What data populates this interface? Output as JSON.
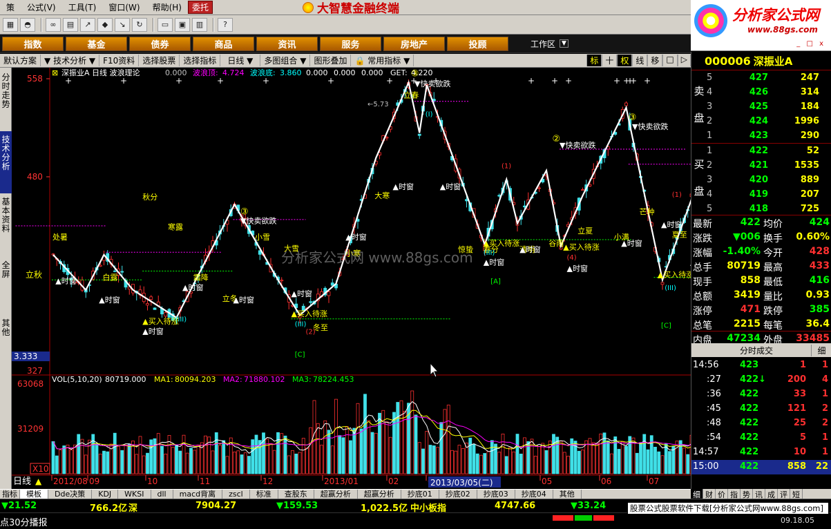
{
  "menubar": {
    "items": [
      "策",
      "公式",
      "工具",
      "窗口",
      "帮助"
    ],
    "shortcuts": [
      "",
      "(V)",
      "(T)",
      "(W)",
      "(H)"
    ],
    "trade_label": "委托",
    "app_title": "大智慧金融终端"
  },
  "toolbar": {
    "icons": [
      "tile-icon",
      "hat-icon",
      "binoculars-icon",
      "grid-icon",
      "buy-arrow-icon",
      "diamond-icon",
      "sell-arrow-icon",
      "refresh-icon",
      "notes-icon",
      "window-icon",
      "books-icon",
      "help-icon"
    ]
  },
  "brand": {
    "name": "分析家公式网",
    "url": "www.88gs.com",
    "window_controls": "_ □ x"
  },
  "navbar": {
    "items": [
      "指数",
      "基金",
      "债券",
      "商品",
      "资讯",
      "服务",
      "房地产",
      "投顾"
    ],
    "workspace_label": "工作区"
  },
  "tabstrip": {
    "items": [
      "默认方案",
      "技术分析",
      "F10资料",
      "选择股票",
      "选择指标",
      "日线",
      "多图组合",
      "图形叠加",
      "常用指标"
    ],
    "right_items": [
      "标",
      "十",
      "权",
      "线",
      "移",
      "□",
      "▷"
    ]
  },
  "lefttabs": {
    "items": [
      "分时走势",
      "技术分析",
      "基本资料",
      "全屏",
      "其他"
    ]
  },
  "chart_data": {
    "type": "candlestick",
    "title": "深振业A 日线 波浪理论",
    "header_values": {
      "wave_top_label": "波浪顶:",
      "wave_top": "4.724",
      "wave_bottom_label": "波浪底:",
      "wave_bottom": "3.860",
      "v3": "0.000",
      "v4": "0.000",
      "v5": "0.000",
      "get_label": "GET:",
      "get": "4.220",
      "zero": "0.000"
    },
    "y_ticks": [
      "558",
      "480",
      "327"
    ],
    "y_ticks_secondary": [
      "立秋"
    ],
    "cursor_value": "3.333",
    "x_ticks": [
      "2012/08",
      "09",
      "10",
      "11",
      "12",
      "2013/01",
      "02",
      "03",
      "05",
      "06",
      "07"
    ],
    "cursor_date": "2013/03/05(二)",
    "period_label": "日线",
    "scale_label": "X10",
    "watermark": "分析家公式网  www.88gs.com",
    "solar_terms": [
      {
        "label": "处暑",
        "x": 0.2,
        "y": 430
      },
      {
        "label": "白露",
        "x": 14,
        "y": 398
      },
      {
        "label": "秋分",
        "x": 25,
        "y": 462
      },
      {
        "label": "寒露",
        "x": 32,
        "y": 438
      },
      {
        "label": "霜降",
        "x": 39,
        "y": 398
      },
      {
        "label": "立冬",
        "x": 47,
        "y": 381
      },
      {
        "label": "小雪",
        "x": 56,
        "y": 430
      },
      {
        "label": "大雪",
        "x": 64,
        "y": 421
      },
      {
        "label": "冬至",
        "x": 72,
        "y": 358
      },
      {
        "label": "小寒",
        "x": 81,
        "y": 417
      },
      {
        "label": "大寒",
        "x": 89,
        "y": 463
      },
      {
        "label": "立春",
        "x": 97,
        "y": 543
      },
      {
        "label": "惊蛰",
        "x": 112,
        "y": 420
      },
      {
        "label": "春分",
        "x": 119,
        "y": 420
      },
      {
        "label": "清明",
        "x": 129,
        "y": 420
      },
      {
        "label": "谷雨",
        "x": 137,
        "y": 425
      },
      {
        "label": "立夏",
        "x": 145,
        "y": 435
      },
      {
        "label": "小满",
        "x": 155,
        "y": 430
      },
      {
        "label": "芒种",
        "x": 162,
        "y": 450
      },
      {
        "label": "夏至",
        "x": 171,
        "y": 432
      },
      {
        "label": "小暑",
        "x": 178,
        "y": 395
      }
    ],
    "signals": [
      {
        "text": "时窗",
        "x": 1,
        "y": 395
      },
      {
        "text": "时窗",
        "x": 13,
        "y": 380
      },
      {
        "text": "时窗",
        "x": 25,
        "y": 355
      },
      {
        "text": "时窗",
        "x": 36,
        "y": 390
      },
      {
        "text": "时窗",
        "x": 50,
        "y": 380
      },
      {
        "text": "时窗",
        "x": 66,
        "y": 385
      },
      {
        "text": "时窗",
        "x": 81,
        "y": 430
      },
      {
        "text": "时窗",
        "x": 94,
        "y": 470
      },
      {
        "text": "时窗",
        "x": 107,
        "y": 470
      },
      {
        "text": "时窗",
        "x": 119,
        "y": 410
      },
      {
        "text": "时窗",
        "x": 129,
        "y": 420
      },
      {
        "text": "时窗",
        "x": 142,
        "y": 405
      },
      {
        "text": "时窗",
        "x": 157,
        "y": 425
      },
      {
        "text": "时窗",
        "x": 168,
        "y": 440
      },
      {
        "text": "时窗",
        "x": 176,
        "y": 410
      }
    ],
    "buy_signals": [
      {
        "text": "买入待涨",
        "x": 25,
        "y": 363
      },
      {
        "text": "买入待涨",
        "x": 66,
        "y": 369
      },
      {
        "text": "买入待涨",
        "x": 119,
        "y": 425
      },
      {
        "text": "买入待涨",
        "x": 141,
        "y": 422
      },
      {
        "text": "买入待涨",
        "x": 167,
        "y": 400
      }
    ],
    "sell_signals": [
      {
        "text": "快卖欲跌",
        "x": 52,
        "y": 443
      },
      {
        "text": "快卖欲跌",
        "x": 100,
        "y": 552
      },
      {
        "text": "快卖欲跌",
        "x": 140,
        "y": 503
      },
      {
        "text": "快卖欲跌",
        "x": 160,
        "y": 518
      },
      {
        "text": "快卖欲跌",
        "x": 180,
        "y": 478
      }
    ],
    "wave_marks": [
      {
        "text": "③",
        "x": 52,
        "y": 450
      },
      {
        "text": "③",
        "x": 99,
        "y": 560
      },
      {
        "text": "②",
        "x": 138,
        "y": 508
      },
      {
        "text": "③",
        "x": 159,
        "y": 525
      },
      {
        "text": "①",
        "x": 179,
        "y": 490
      },
      {
        "text": "(I)",
        "x": 103,
        "y": 528
      },
      {
        "text": "(III)",
        "x": 34,
        "y": 365
      },
      {
        "text": "(III)",
        "x": 67,
        "y": 361
      },
      {
        "text": "(III)",
        "x": 119,
        "y": 418
      },
      {
        "text": "(III)",
        "x": 169,
        "y": 390
      },
      {
        "text": "(1)",
        "x": 124,
        "y": 487
      },
      {
        "text": "(1)",
        "x": 171,
        "y": 464
      },
      {
        "text": "(4)",
        "x": 142,
        "y": 414
      },
      {
        "text": "(2)",
        "x": 70,
        "y": 355
      }
    ],
    "label_boxes": [
      {
        "text": "[A]",
        "x": 121,
        "y": 395
      },
      {
        "text": "[C]",
        "x": 168,
        "y": 360
      },
      {
        "text": "[C]",
        "x": 67,
        "y": 337
      }
    ],
    "price_prev_label": "←5.73",
    "wave_path": [
      [
        0,
        418
      ],
      [
        9,
        390
      ],
      [
        14,
        418
      ],
      [
        22,
        390
      ],
      [
        34,
        368
      ],
      [
        50,
        458
      ],
      [
        62,
        398
      ],
      [
        68,
        370
      ],
      [
        78,
        395
      ],
      [
        89,
        495
      ],
      [
        98,
        555
      ],
      [
        101,
        515
      ],
      [
        103,
        553
      ],
      [
        119,
        426
      ],
      [
        125,
        478
      ],
      [
        128,
        443
      ],
      [
        136,
        485
      ],
      [
        140,
        425
      ],
      [
        146,
        465
      ],
      [
        158,
        535
      ],
      [
        168,
        398
      ],
      [
        176,
        462
      ],
      [
        180,
        445
      ],
      [
        183,
        460
      ]
    ],
    "volume": {
      "title": "VOL(5,10,20)",
      "vol": "80719.000",
      "ma1_label": "MA1:",
      "ma1": "80094.203",
      "ma2_label": "MA2:",
      "ma2": "71880.102",
      "ma3_label": "MA3:",
      "ma3": "78224.453",
      "y_ticks": [
        "63068",
        "31209"
      ]
    }
  },
  "quote": {
    "code": "000006",
    "name": "深振业A",
    "sell_label": [
      "卖",
      "盘"
    ],
    "buy_label": [
      "买",
      "盘"
    ],
    "asks": [
      {
        "level": "5",
        "price": "427",
        "vol": "247"
      },
      {
        "level": "4",
        "price": "426",
        "vol": "314"
      },
      {
        "level": "3",
        "price": "425",
        "vol": "184"
      },
      {
        "level": "2",
        "price": "424",
        "vol": "1996"
      },
      {
        "level": "1",
        "price": "423",
        "vol": "290"
      }
    ],
    "bids": [
      {
        "level": "1",
        "price": "422",
        "vol": "52"
      },
      {
        "level": "2",
        "price": "421",
        "vol": "1535"
      },
      {
        "level": "3",
        "price": "420",
        "vol": "889"
      },
      {
        "level": "4",
        "price": "419",
        "vol": "207"
      },
      {
        "level": "5",
        "price": "418",
        "vol": "725"
      }
    ],
    "stats": [
      {
        "l1": "最新",
        "v1": "422",
        "l2": "均价",
        "v2": "424"
      },
      {
        "l1": "涨跌",
        "v1": "▼006",
        "l2": "换手",
        "v2": "0.60%"
      },
      {
        "l1": "涨幅",
        "v1": "-1.40%",
        "l2": "今开",
        "v2": "428"
      },
      {
        "l1": "总手",
        "v1": "80719",
        "l2": "最高",
        "v2": "433"
      },
      {
        "l1": "现手",
        "v1": "858",
        "l2": "最低",
        "v2": "416"
      },
      {
        "l1": "总额",
        "v1": "3419",
        "l2": "量比",
        "v2": "0.93"
      },
      {
        "l1": "涨停",
        "v1": "471",
        "l2": "跌停",
        "v2": "385"
      },
      {
        "l1": "总笔",
        "v1": "2215",
        "l2": "每笔",
        "v2": "36.4"
      },
      {
        "l1": "内盘",
        "v1": "47234",
        "l2": "外盘",
        "v2": "33485"
      }
    ],
    "tick_header": "分时成交",
    "tick_header_btn": "细",
    "ticks": [
      {
        "time": "14:56",
        "price": "423",
        "vol": "1",
        "n": "1"
      },
      {
        "time": ":27",
        "price": "422",
        "vol": "200",
        "n": "4"
      },
      {
        "time": ":36",
        "price": "422",
        "vol": "33",
        "n": "1"
      },
      {
        "time": ":45",
        "price": "422",
        "vol": "121",
        "n": "2"
      },
      {
        "time": ":48",
        "price": "422",
        "vol": "25",
        "n": "2"
      },
      {
        "time": ":54",
        "price": "422",
        "vol": "5",
        "n": "1"
      },
      {
        "time": "14:57",
        "price": "422",
        "vol": "10",
        "n": "1"
      },
      {
        "time": "15:00",
        "price": "422",
        "vol": "858",
        "n": "22"
      }
    ],
    "bottom_tabs": [
      "细",
      "财",
      "价",
      "指",
      "势",
      "讯",
      "成",
      "评",
      "短"
    ]
  },
  "indicator_tabs": [
    "指标",
    "模板",
    "Dde决策",
    "KDJ",
    "WKSI",
    "dll",
    "macd背离",
    "zscl",
    "标准",
    "查股东",
    "超赢分析",
    "超赢分析",
    "抄底01",
    "抄底02",
    "抄底03",
    "抄底04",
    "其他"
  ],
  "statusbar": {
    "left_change": "▼21.52",
    "sh_amount": "766.2亿",
    "sz_label": "深",
    "sz_index": "7904.27",
    "sz_change": "▼159.53",
    "sz_amount": "1,022.5亿",
    "sme_label": "中小板指",
    "sme_index": "4747.66",
    "sme_change": "▼33.24"
  },
  "footbar": {
    "left": "点30分播报",
    "ad": "股票公式股票软件下载[分析家公式网www.88gs.com]",
    "clock": "09.18.05"
  }
}
